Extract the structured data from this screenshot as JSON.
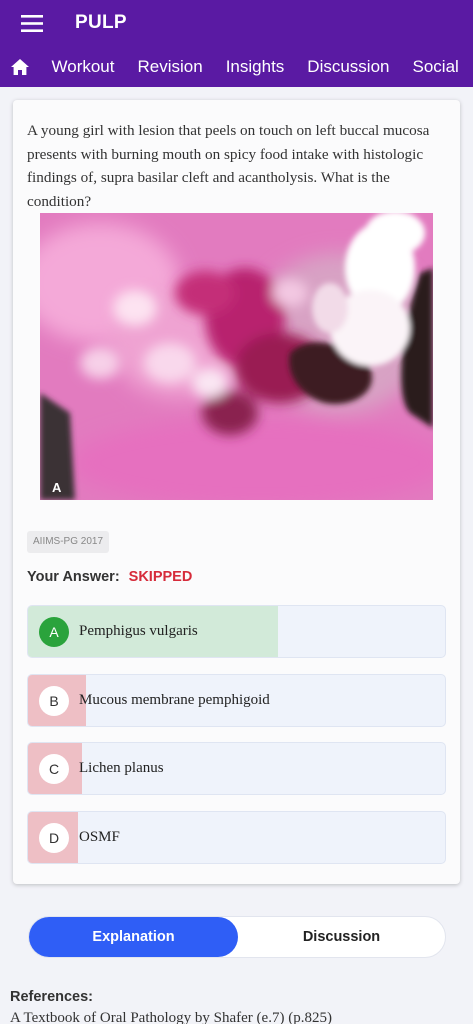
{
  "app": {
    "title": "PULP"
  },
  "nav": {
    "tabs": [
      "Workout",
      "Revision",
      "Insights",
      "Discussion",
      "Social"
    ]
  },
  "question": {
    "text": "A young girl with lesion that peels on touch on left buccal mucosa presents with burning mouth on spicy food intake with histologic findings of, supra basilar cleft and acantholysis. What is the condition?",
    "image_label": "A",
    "source_tag": "AIIMS-PG 2017"
  },
  "answer": {
    "label": "Your Answer:",
    "status": "SKIPPED"
  },
  "options": [
    {
      "letter": "A",
      "text": "Pemphigus vulgaris",
      "correct": true,
      "response_share": 0.6
    },
    {
      "letter": "B",
      "text": "Mucous membrane pemphigoid",
      "correct": false,
      "response_share": 0.14
    },
    {
      "letter": "C",
      "text": "Lichen planus",
      "correct": false,
      "response_share": 0.13
    },
    {
      "letter": "D",
      "text": "OSMF",
      "correct": false,
      "response_share": 0.12
    }
  ],
  "colors": {
    "app_bar": "#5a1aa3",
    "correct_fill": "#d2ead9",
    "wrong_fill": "#eebfc5",
    "status_skipped": "#d62b3a",
    "active_segment": "#2f5ef6"
  },
  "segment": {
    "explanation": "Explanation",
    "discussion": "Discussion"
  },
  "references": {
    "title": "References:",
    "items": [
      "A Textbook of Oral Pathology by Shafer (e.7) (p.825)"
    ]
  }
}
